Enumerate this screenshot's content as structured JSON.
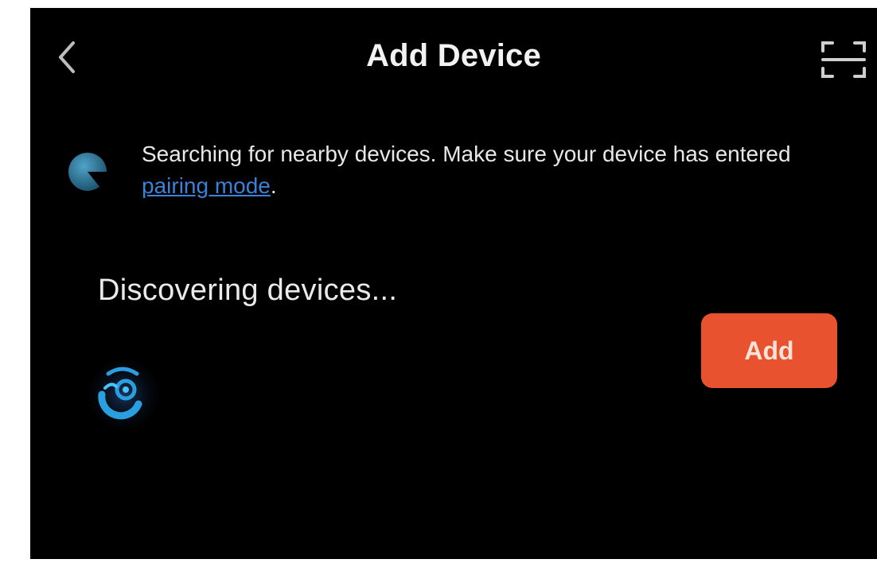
{
  "header": {
    "title": "Add Device",
    "back_icon": "chevron-left-icon",
    "scan_icon": "scan-icon"
  },
  "notice": {
    "icon": "searching-spinner-icon",
    "text_before": "Searching for nearby devices. Make sure your device has entered ",
    "link": "pairing mode",
    "text_after": "."
  },
  "discover": {
    "title": "Discovering devices...",
    "device_icon": "device-app-icon",
    "add_label": "Add"
  },
  "colors": {
    "background": "#000000",
    "accent": "#e8522e",
    "link": "#3b82d6",
    "icon_blue": "#2a9fe0"
  }
}
